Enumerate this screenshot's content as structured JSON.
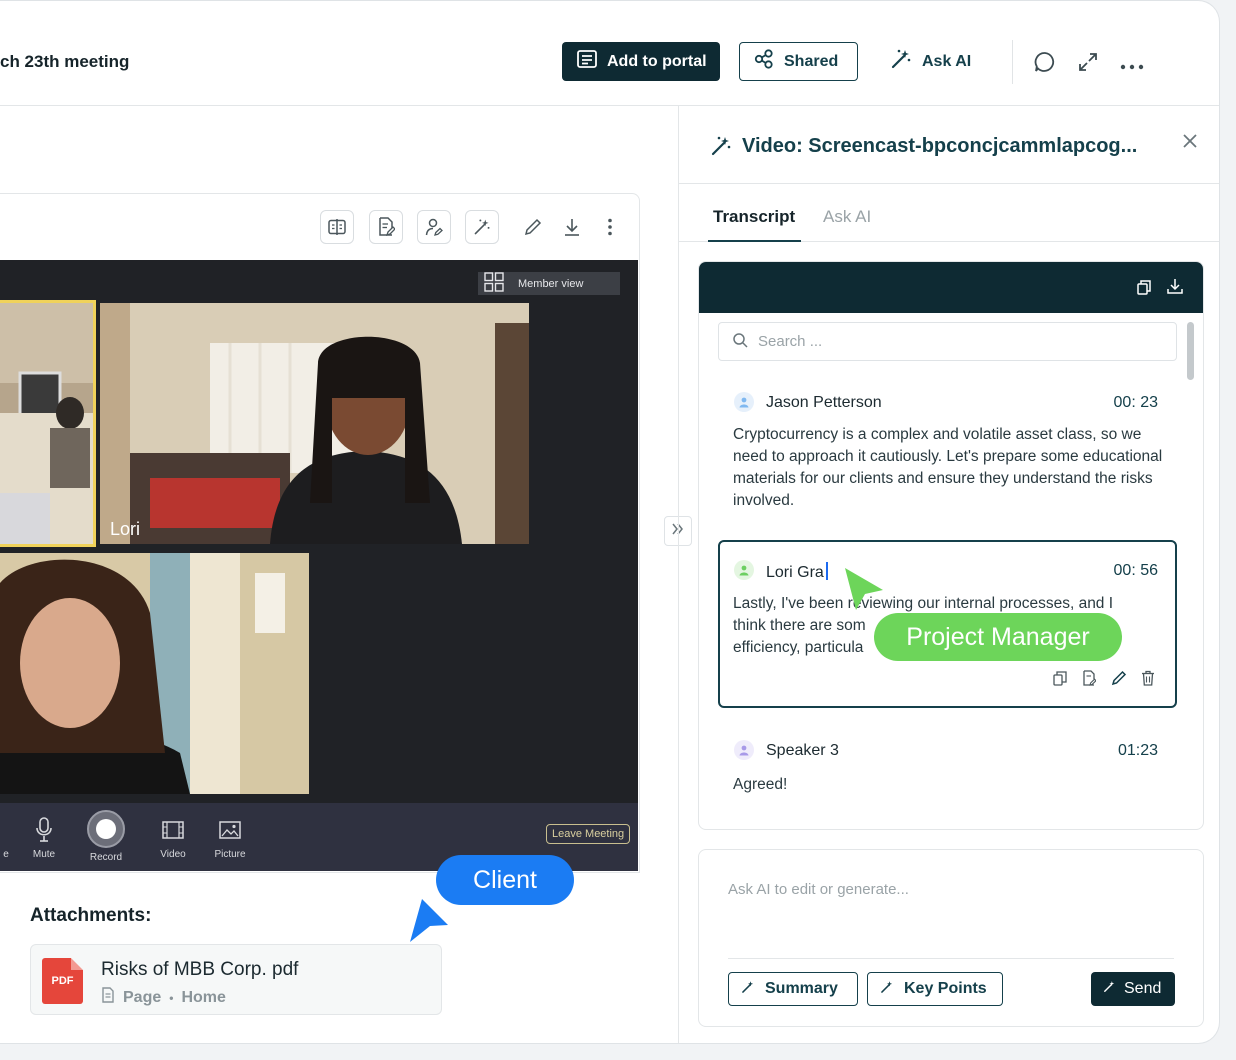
{
  "header": {
    "page_title": "ch 23th meeting",
    "add_to_portal_label": "Add to portal",
    "shared_label": "Shared",
    "ask_ai_label": "Ask AI"
  },
  "video": {
    "member_view_label": "Member view",
    "tile_label_lori": "Lori",
    "controls": {
      "partial_label": "e",
      "mute_label": "Mute",
      "record_label": "Record",
      "video_label": "Video",
      "picture_label": "Picture",
      "leave_label": "Leave Meeting"
    }
  },
  "attachments": {
    "title": "Attachments:",
    "file_name": "Risks of MBB Corp. pdf",
    "file_type": "PDF",
    "meta_page": "Page",
    "meta_dot": "•",
    "meta_home": "Home"
  },
  "overlays": {
    "client_label": "Client",
    "pm_label": "Project Manager"
  },
  "panel": {
    "title": "Video: Screencast-bpconcjcammlapcog...",
    "tabs": [
      {
        "label": "Transcript",
        "active": true
      },
      {
        "label": "Ask AI",
        "active": false
      }
    ],
    "search_placeholder": "Search ...",
    "entries": [
      {
        "speaker": "Jason Petterson",
        "time": "00: 23",
        "text": "Cryptocurrency is a complex and volatile asset class, so we need to approach it cautiously. Let's prepare some educational materials for our clients and ensure they understand the risks involved.",
        "avatar_color": "#7fb8f0"
      },
      {
        "speaker": "Lori Gra",
        "time": "00: 56",
        "text_line1": "Lastly, I've been reviewing our internal processes, and I",
        "text_line2": "think there are som",
        "text_line3": "efficiency, particula",
        "avatar_color": "#6dcf62"
      },
      {
        "speaker": "Speaker 3",
        "time": "01:23",
        "text": "Agreed!",
        "avatar_color": "#a89ae8"
      }
    ],
    "ask_placeholder": "Ask AI to edit or generate...",
    "summary_label": "Summary",
    "key_points_label": "Key Points",
    "send_label": "Send"
  },
  "colors": {
    "primary_dark": "#0e2a33",
    "accent_teal": "#15404b",
    "client_blue": "#1b7cf3",
    "pm_green": "#6dd55a"
  }
}
